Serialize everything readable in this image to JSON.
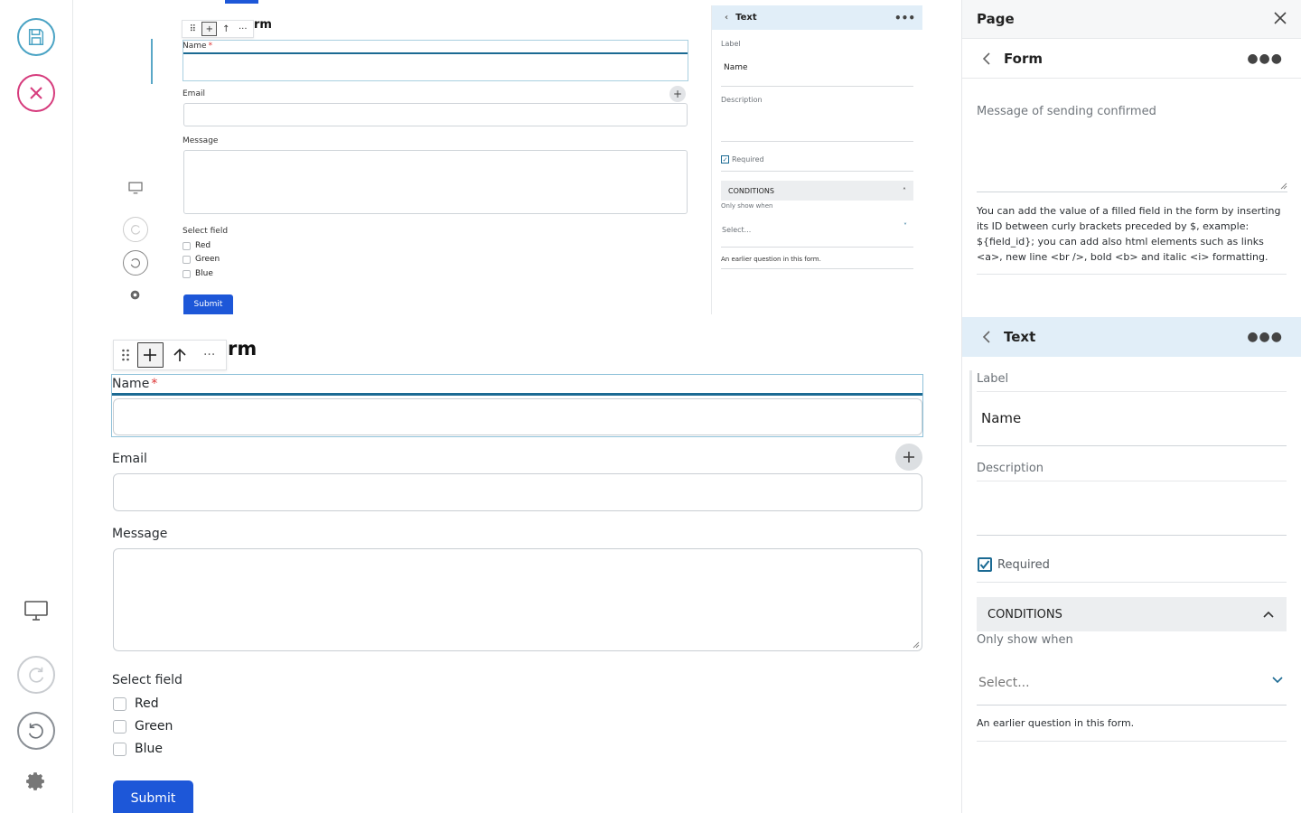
{
  "rail": {
    "save_label": "Save",
    "close_label": "Close",
    "colors": {
      "save": "#4aa3c4",
      "close": "#d63c7d"
    }
  },
  "form": {
    "title": "rm",
    "fields": {
      "name_label": "Name",
      "required_mark": "*",
      "email_label": "Email",
      "message_label": "Message",
      "select_label": "Select field",
      "options": [
        "Red",
        "Green",
        "Blue"
      ]
    },
    "submit_label": "Submit",
    "toolbar_more": "···"
  },
  "mini_panel": {
    "title": "Text",
    "label_label": "Label",
    "label_value": "Name",
    "description_label": "Description",
    "required_label": "Required",
    "conditions_label": "CONDITIONS",
    "only_show_when": "Only show when",
    "select_placeholder": "Select...",
    "help": "An earlier question in this form."
  },
  "panel": {
    "header_title": "Page",
    "form_title": "Form",
    "message_placeholder": "Message of sending confirmed",
    "help_text": "You can add the value of a filled field in the form by inserting its ID between curly brackets preceded by $, example: ${field_id}; you can add also html elements such as links <a>, new line <br />, bold <b> and italic <i> formatting.",
    "text_title": "Text",
    "label_label": "Label",
    "label_value": "Name",
    "description_label": "Description",
    "required_label": "Required",
    "conditions_label": "CONDITIONS",
    "only_show_when": "Only show when",
    "select_placeholder": "Select...",
    "condition_help": "An earlier question in this form."
  },
  "colors": {
    "accent": "#1b6a93",
    "primary_button": "#1d57d8",
    "selected_header": "#e1eef8"
  }
}
